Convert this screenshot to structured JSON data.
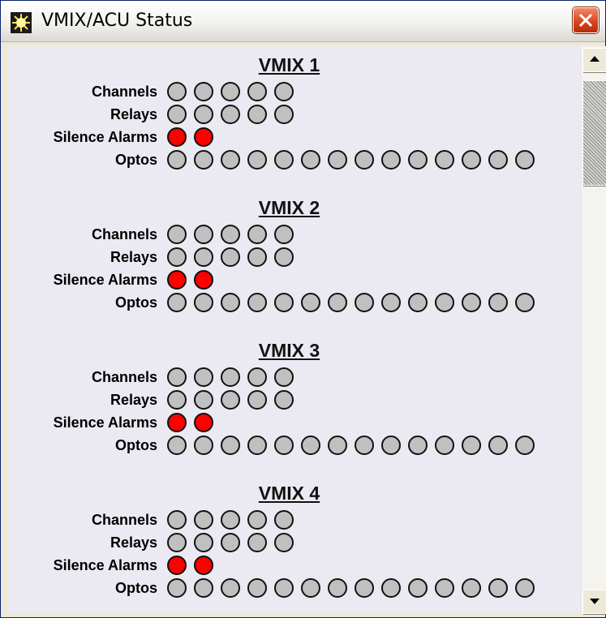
{
  "window": {
    "title": "VMIX/ACU Status"
  },
  "colors": {
    "led_off": "#c0c0c0",
    "led_on": "#ff0000",
    "content_bg": "#ebeaf2"
  },
  "row_labels": {
    "channels": "Channels",
    "relays": "Relays",
    "silence_alarms": "Silence Alarms",
    "optos": "Optos"
  },
  "sections": [
    {
      "title": "VMIX 1",
      "channels": [
        0,
        0,
        0,
        0,
        0
      ],
      "relays": [
        0,
        0,
        0,
        0,
        0
      ],
      "silence_alarms": [
        1,
        1
      ],
      "optos": [
        0,
        0,
        0,
        0,
        0,
        0,
        0,
        0,
        0,
        0,
        0,
        0,
        0,
        0
      ]
    },
    {
      "title": "VMIX 2",
      "channels": [
        0,
        0,
        0,
        0,
        0
      ],
      "relays": [
        0,
        0,
        0,
        0,
        0
      ],
      "silence_alarms": [
        1,
        1
      ],
      "optos": [
        0,
        0,
        0,
        0,
        0,
        0,
        0,
        0,
        0,
        0,
        0,
        0,
        0,
        0
      ]
    },
    {
      "title": "VMIX 3",
      "channels": [
        0,
        0,
        0,
        0,
        0
      ],
      "relays": [
        0,
        0,
        0,
        0,
        0
      ],
      "silence_alarms": [
        1,
        1
      ],
      "optos": [
        0,
        0,
        0,
        0,
        0,
        0,
        0,
        0,
        0,
        0,
        0,
        0,
        0,
        0
      ]
    },
    {
      "title": "VMIX 4",
      "channels": [
        0,
        0,
        0,
        0,
        0
      ],
      "relays": [
        0,
        0,
        0,
        0,
        0
      ],
      "silence_alarms": [
        1,
        1
      ],
      "optos": [
        0,
        0,
        0,
        0,
        0,
        0,
        0,
        0,
        0,
        0,
        0,
        0,
        0,
        0
      ]
    }
  ]
}
